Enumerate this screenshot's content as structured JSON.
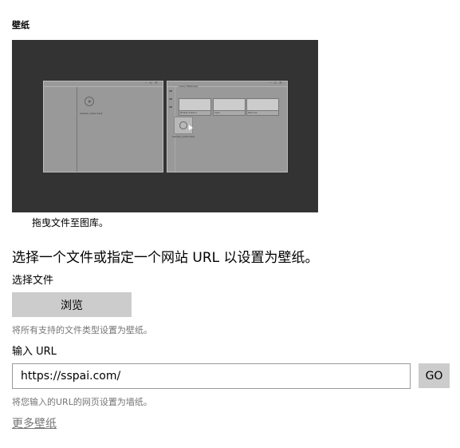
{
  "section": {
    "title": "壁纸"
  },
  "preview": {
    "caption": "拖曳文件至图库。",
    "left_window": {
      "file_name": "sample_video.mp4"
    },
    "right_window": {
      "app_title": "Lively Wallpaper",
      "cards": [
        "Parallax & Blend",
        "Layer",
        "Next Live"
      ]
    },
    "drag_item_label": "sample_video.mp4",
    "colors": {
      "background": "#333333",
      "window": "#999999",
      "card": "#cccccc"
    }
  },
  "main": {
    "subtitle": "选择一个文件或指定一个网站 URL 以设置为壁纸。",
    "file_section": {
      "label": "选择文件",
      "browse_label": "浏览",
      "hint": "将所有支持的文件类型设置为壁纸。"
    },
    "url_section": {
      "label": "输入 URL",
      "input_value": "https://sspai.com/",
      "go_label": "GO",
      "hint": "将您输入的URL的网页设置为墙纸。"
    },
    "more_link": "更多壁纸"
  }
}
